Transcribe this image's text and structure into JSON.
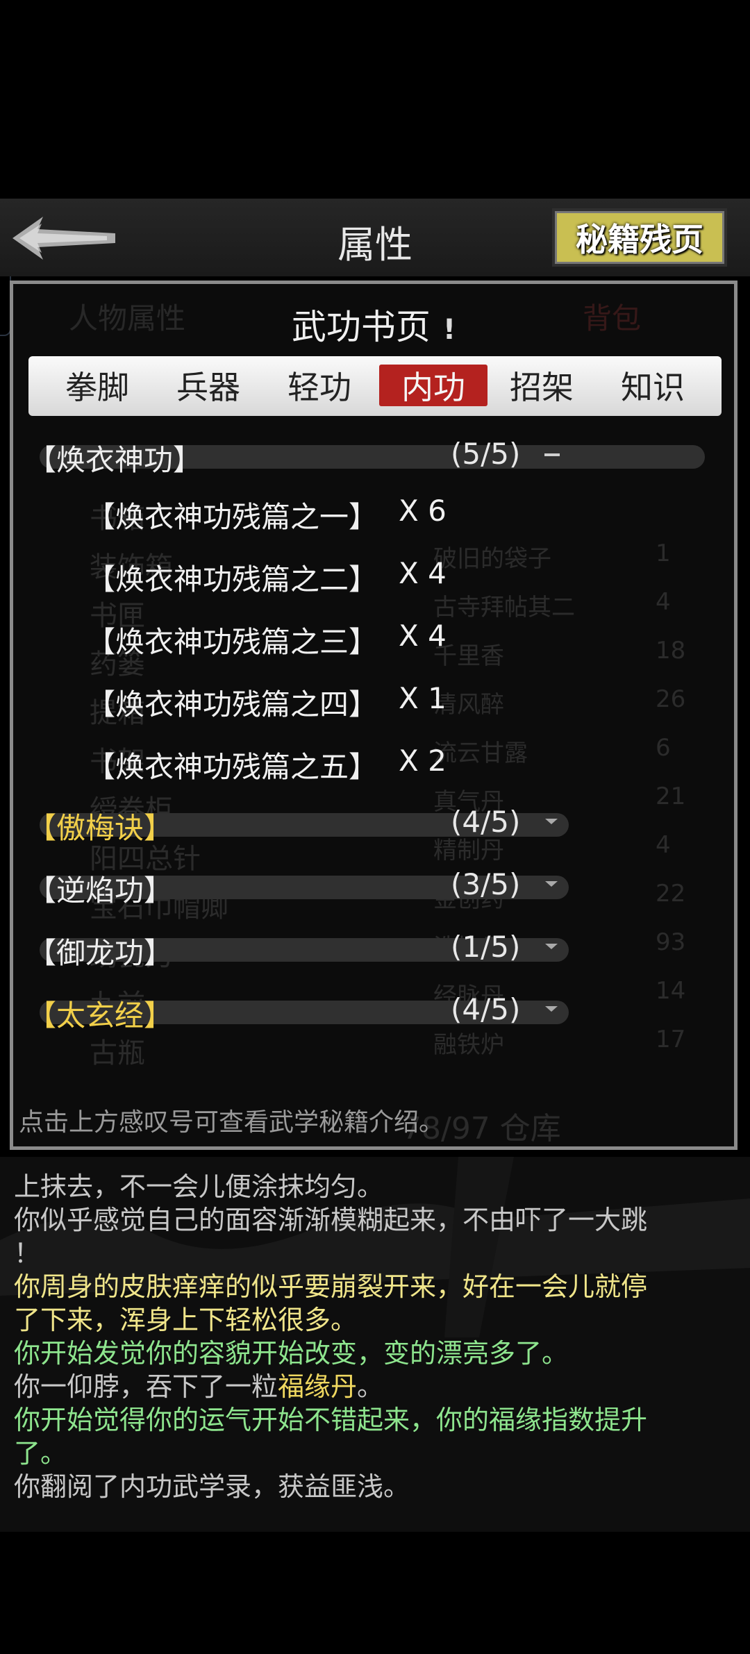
{
  "header": {
    "title": "属性",
    "fragment_button": "秘籍残页"
  },
  "panel": {
    "title": "武功书页",
    "info_mark": "!",
    "background_tabs": [
      "人物属性",
      "背包"
    ],
    "background_left_items": [
      "书箱",
      "装饰箱",
      "书匣",
      "药篓",
      "提箱",
      "书架",
      "绶卷柜",
      "阳四总针",
      "宝石巾帽卿",
      "绣瓷刀",
      "九前",
      "古瓶"
    ],
    "background_right_items": [
      {
        "name": "破旧的袋子",
        "count": "1"
      },
      {
        "name": "古寺拜帖其二",
        "count": "4"
      },
      {
        "name": "千里香",
        "count": "18"
      },
      {
        "name": "清风醉",
        "count": "26"
      },
      {
        "name": "流云甘露",
        "count": "6"
      },
      {
        "name": "真气丹",
        "count": "21"
      },
      {
        "name": "精制丹",
        "count": "4"
      },
      {
        "name": "金创药",
        "count": "22"
      },
      {
        "name": "洗炼丹",
        "count": "93"
      },
      {
        "name": "经脉丹",
        "count": "14"
      },
      {
        "name": "融铁炉",
        "count": "17"
      }
    ],
    "background_footer": "78/97 仓库",
    "tabs": [
      "拳脚",
      "兵器",
      "轻功",
      "内功",
      "招架",
      "知识"
    ],
    "active_tab": "内功",
    "groups": [
      {
        "name": "【焕衣神功】",
        "count": "(5/5)",
        "expanded": true,
        "highlight": false
      },
      {
        "name": "【傲梅诀】",
        "count": "(4/5)",
        "expanded": false,
        "highlight": true
      },
      {
        "name": "【逆焰功】",
        "count": "(3/5)",
        "expanded": false,
        "highlight": false
      },
      {
        "name": "【御龙功】",
        "count": "(1/5)",
        "expanded": false,
        "highlight": false
      },
      {
        "name": "【太玄经】",
        "count": "(4/5)",
        "expanded": false,
        "highlight": true
      }
    ],
    "expanded_items": [
      {
        "name": "【焕衣神功残篇之一】",
        "qty": "X 6"
      },
      {
        "name": "【焕衣神功残篇之二】",
        "qty": "X 4"
      },
      {
        "name": "【焕衣神功残篇之三】",
        "qty": "X 4"
      },
      {
        "name": "【焕衣神功残篇之四】",
        "qty": "X 1"
      },
      {
        "name": "【焕衣神功残篇之五】",
        "qty": "X 2"
      }
    ],
    "hint": "点击上方感叹号可查看武学秘籍介绍。"
  },
  "log": [
    {
      "text": "上抹去，不一会儿便涂抹均匀。",
      "color": "white"
    },
    {
      "text": "你似乎感觉自己的面容渐渐模糊起来，不由吓了一大跳",
      "color": "white"
    },
    {
      "text": "！",
      "color": "white"
    },
    {
      "text": "你周身的皮肤痒痒的似乎要崩裂开来，好在一会儿就停",
      "color": "yellow"
    },
    {
      "text": "了下来，浑身上下轻松很多。",
      "color": "yellow"
    },
    {
      "text": "你开始发觉你的容貌开始改变，变的漂亮多了。",
      "color": "green"
    },
    {
      "text": "你一仰脖，吞下了一粒",
      "color": "white",
      "suffix": "福缘丹",
      "suffix_color": "amber",
      "tail": "。"
    },
    {
      "text": "你开始觉得你的运气开始不错起来，你的福缘指数提升",
      "color": "green"
    },
    {
      "text": "了。",
      "color": "green"
    },
    {
      "text": "你翻阅了内功武学录，获益匪浅。",
      "color": "white"
    }
  ]
}
